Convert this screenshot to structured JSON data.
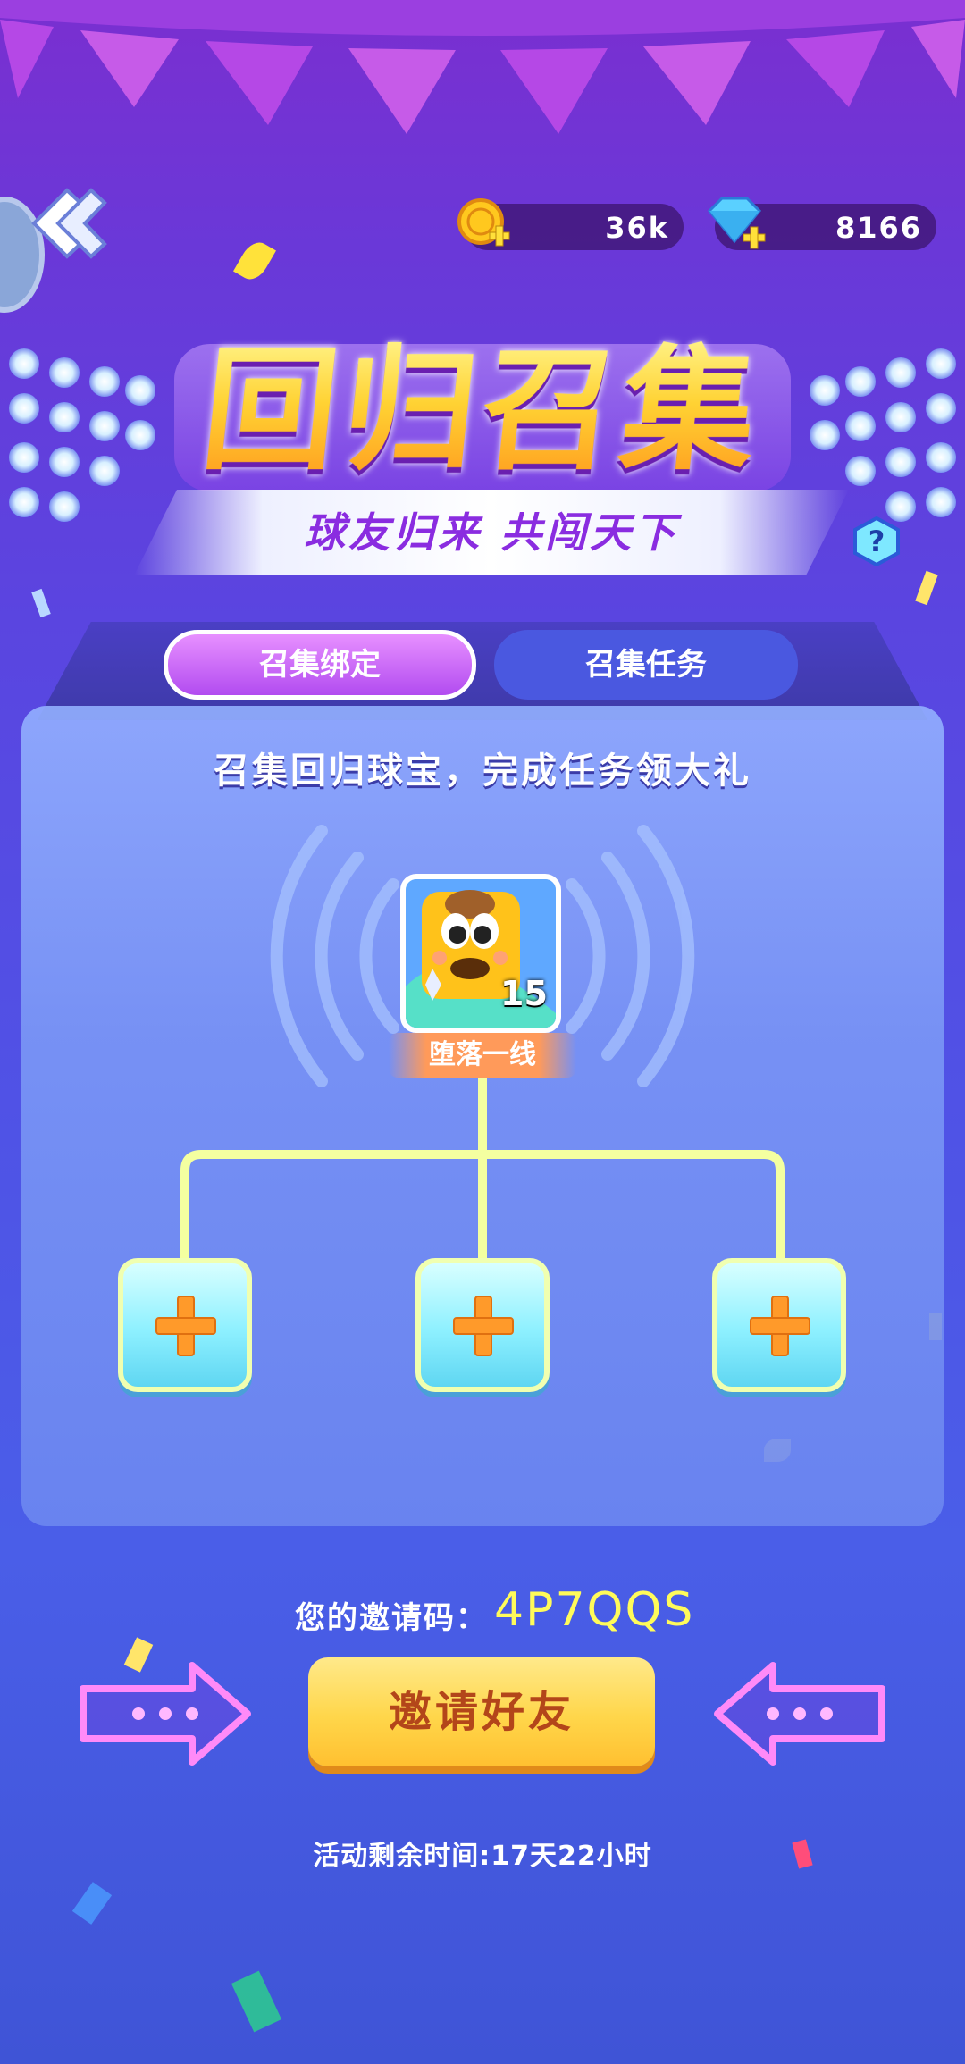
{
  "currency": {
    "coins": "36k",
    "gems": "8166",
    "coin_icon": "coin-plus-icon",
    "gem_icon": "diamond-plus-icon"
  },
  "header": {
    "title": "回归召集",
    "subtitle": "球友归来 共闯天下",
    "help_icon": "question-icon",
    "back_icon": "double-chevron-left-icon"
  },
  "tabs": [
    {
      "label": "召集绑定",
      "active": true
    },
    {
      "label": "召集任务",
      "active": false
    }
  ],
  "panel": {
    "description": "召集回归球宝，完成任务领大礼",
    "player": {
      "level": "15",
      "nickname": "堕落一线"
    },
    "slots": [
      {
        "icon": "plus-icon"
      },
      {
        "icon": "plus-icon"
      },
      {
        "icon": "plus-icon"
      }
    ]
  },
  "invite": {
    "label": "您的邀请码：",
    "code": "4P7QQS",
    "button_label": "邀请好友"
  },
  "remaining_time": "活动剩余时间:17天22小时",
  "colors": {
    "accent_yellow": "#ffd64a",
    "code_yellow": "#fffb5a",
    "tab_active": "#c05af2",
    "tab_inactive": "#4a58e0"
  }
}
